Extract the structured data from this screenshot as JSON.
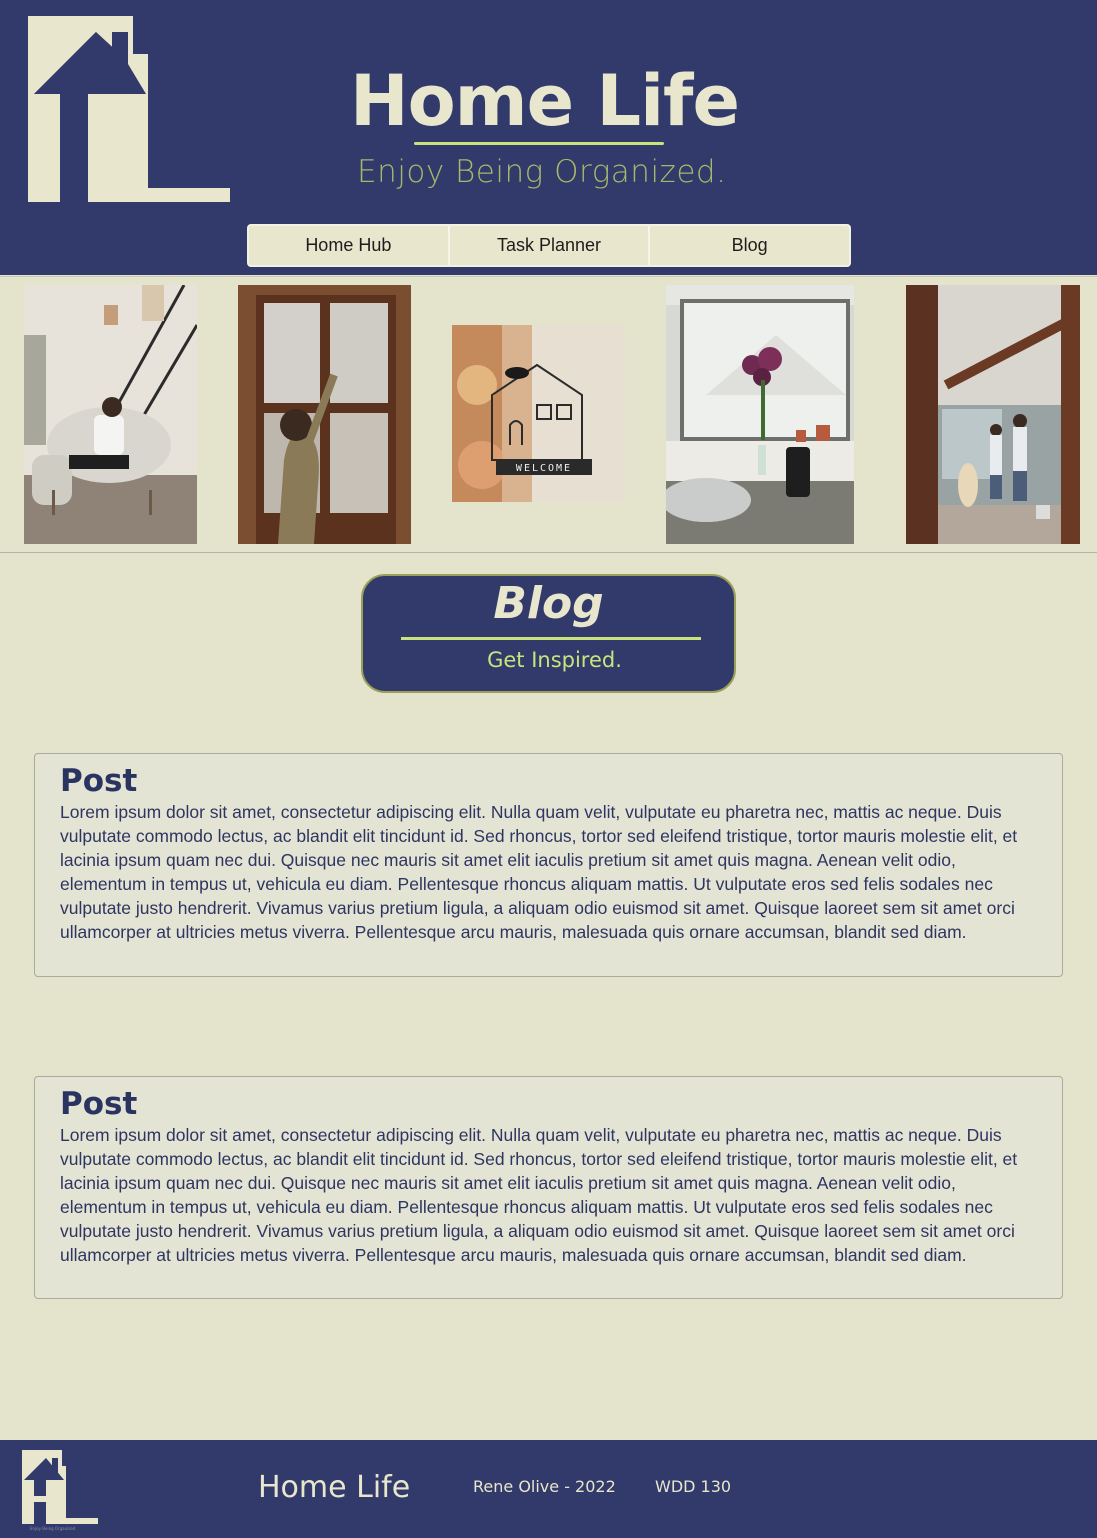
{
  "header": {
    "title": "Home Life",
    "tagline": "Enjoy Being Organized."
  },
  "nav": {
    "items": [
      {
        "label": "Home Hub"
      },
      {
        "label": "Task Planner"
      },
      {
        "label": "Blog"
      }
    ]
  },
  "gallery": {
    "photos": [
      {
        "name": "woman-on-armchair-photo"
      },
      {
        "name": "woman-at-window-photo"
      },
      {
        "name": "welcome-sign-photo"
      },
      {
        "name": "kitchen-window-flowers-photo"
      },
      {
        "name": "couple-with-dog-photo"
      }
    ],
    "welcome_sign": "WELCOME"
  },
  "banner": {
    "title": "Blog",
    "subtitle": "Get Inspired."
  },
  "posts": [
    {
      "title": "Post",
      "body": "Lorem ipsum dolor sit amet, consectetur adipiscing elit. Nulla quam velit, vulputate eu pharetra nec, mattis ac neque. Duis vulputate commodo lectus, ac blandit elit tincidunt id. Sed rhoncus, tortor sed eleifend tristique, tortor mauris molestie elit, et lacinia ipsum quam nec dui. Quisque nec mauris sit amet elit iaculis pretium sit amet quis magna. Aenean velit odio, elementum in tempus ut, vehicula eu diam. Pellentesque rhoncus aliquam mattis. Ut vulputate eros sed felis sodales nec vulputate justo hendrerit. Vivamus varius pretium ligula, a aliquam odio euismod sit amet. Quisque laoreet sem sit amet orci ullamcorper at ultricies metus viverra. Pellentesque arcu mauris, malesuada quis ornare accumsan, blandit sed diam."
    },
    {
      "title": "Post",
      "body": "Lorem ipsum dolor sit amet, consectetur adipiscing elit. Nulla quam velit, vulputate eu pharetra nec, mattis ac neque. Duis vulputate commodo lectus, ac blandit elit tincidunt id. Sed rhoncus, tortor sed eleifend tristique, tortor mauris molestie elit, et lacinia ipsum quam nec dui. Quisque nec mauris sit amet elit iaculis pretium sit amet quis magna. Aenean velit odio, elementum in tempus ut, vehicula eu diam. Pellentesque rhoncus aliquam mattis. Ut vulputate eros sed felis sodales nec vulputate justo hendrerit. Vivamus varius pretium ligula, a aliquam odio euismod sit amet. Quisque laoreet sem sit amet orci ullamcorper at ultricies metus viverra. Pellentesque arcu mauris, malesuada quis ornare accumsan, blandit sed diam."
    }
  ],
  "footer": {
    "title": "Home Life",
    "author": "Rene Olive - 2022",
    "course": "WDD 130",
    "logo_tagline": "Enjoy Being Organized"
  },
  "colors": {
    "navy": "#313a6a",
    "cream": "#e8e6cc",
    "lime": "#c9e47d",
    "olive": "#a8b86a",
    "page": "#e4e3cb"
  }
}
